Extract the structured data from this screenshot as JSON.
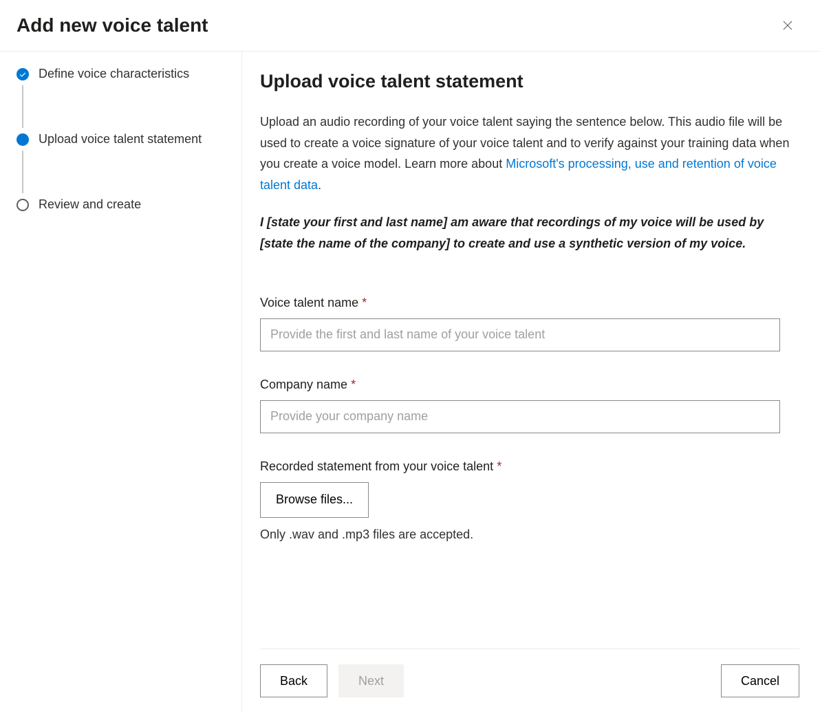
{
  "header": {
    "title": "Add new voice talent"
  },
  "sidebar": {
    "steps": [
      {
        "label": "Define voice characteristics",
        "state": "completed"
      },
      {
        "label": "Upload voice talent statement",
        "state": "active"
      },
      {
        "label": "Review and create",
        "state": "pending"
      }
    ]
  },
  "content": {
    "heading": "Upload voice talent statement",
    "description_text": "Upload an audio recording of your voice talent saying the sentence below. This audio file will be used to create a voice signature of your voice talent and to verify against your training data when you create a voice model. Learn more about ",
    "description_link": "Microsoft's processing, use and retention of voice talent data",
    "description_period": ".",
    "statement": "I [state your first and last name] am aware that recordings of my voice will be used by [state the name of the company] to create and use a synthetic version of my voice.",
    "form": {
      "voice_talent_name": {
        "label": "Voice talent name",
        "placeholder": "Provide the first and last name of your voice talent",
        "value": ""
      },
      "company_name": {
        "label": "Company name",
        "placeholder": "Provide your company name",
        "value": ""
      },
      "recorded_statement": {
        "label": "Recorded statement from your voice talent",
        "browse_label": "Browse files...",
        "help_text": "Only .wav and .mp3 files are accepted."
      }
    }
  },
  "footer": {
    "back_label": "Back",
    "next_label": "Next",
    "cancel_label": "Cancel"
  }
}
